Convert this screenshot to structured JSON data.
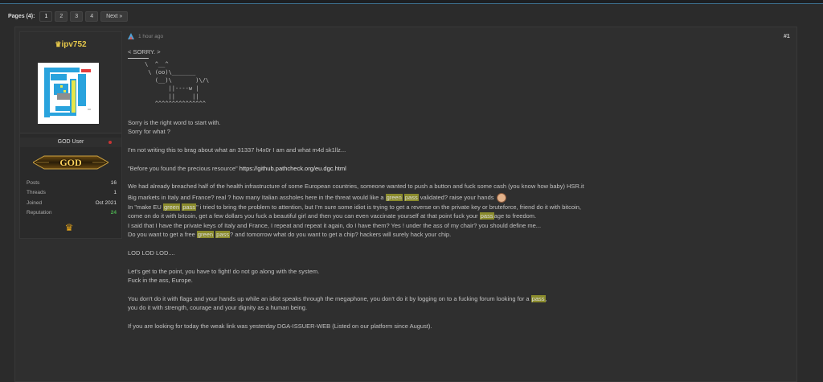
{
  "pagination": {
    "label": "Pages (4):",
    "pages": [
      "1",
      "2",
      "3",
      "4"
    ],
    "next": "Next »"
  },
  "user": {
    "name": "ipv752",
    "title": "GOD User",
    "rank": "GOD",
    "stats": [
      {
        "label": "Posts",
        "value": "16"
      },
      {
        "label": "Threads",
        "value": "1"
      },
      {
        "label": "Joined",
        "value": "Oct 2021"
      },
      {
        "label": "Reputation",
        "value": "24"
      }
    ]
  },
  "post": {
    "time": "1 hour ago",
    "number": "#1",
    "line_sorry": "< SORRY. >",
    "ascii": [
      "     \\  ^__^",
      "      \\ (oo)\\_______",
      "        (__)\\       )\\/\\",
      "            ||----w |",
      "            ||     ||",
      "        ^^^^^^^^^^^^^^^"
    ],
    "p1": "Sorry is the right word to start with.",
    "p2": "Sorry for what ?",
    "p3": "I'm not writing this to brag about what an 31337 h4x0r I am and what m4d sk1llz...",
    "p4_pre": "\"Before you found the precious resource\" ",
    "p4_link": "https://github.pathcheck.org/eu.dgc.html",
    "p5": "We had already breached half of the health infrastructure of some European countries, someone wanted to push a button and fuck some cash (you know how baby) HSR.it",
    "p6_a": "Big markets in Italy and France? real ? how many Italian assholes here in the threat would like a ",
    "hl_green": "green",
    "hl_pass": "pass",
    "p6_b": " validated? raise your hands",
    "p7_a": "In \"make EU ",
    "p7_b": "\" i tried to bring the problem to attention, but I'm sure some idiot is trying to get a reverse on the private key or bruteforce, friend do it with bitcoin,",
    "p8": "come on do it with bitcoin, get a few dollars you fuck a beautiful girl and then you can even vaccinate yourself at that point fuck your ",
    "p8_hl": "pass",
    "p8_b": "age to freedom.",
    "p9": "I said that I have the private keys of Italy and France, I repeat and repeat it again, do I have them? Yes ! under the ass of my chair? you should define me...",
    "p10_a": "Do you want to get a free ",
    "p10_b": "? and tomorrow what do you want to get a chip? hackers will surely hack your chip.",
    "p11": "LOD LOD LOD....",
    "p12": "Let's get to the point, you have to fight! do not go along with the system.",
    "p13": "Fuck in the ass, Europe.",
    "p14_a": "You don't do it with flags and your hands up while an idiot speaks through the megaphone, you don't do it by logging on to a fucking forum looking for a ",
    "p14_b": ",",
    "p15": "you do it with strength, courage and your dignity as a human being.",
    "p16": "If you are looking for today the weak link was yesterday DGA-ISSUER-WEB (Listed on our platform since August)."
  },
  "colors": {
    "background": "#2b2b2b",
    "username": "#e6c84a",
    "highlight": "#8a8b2c",
    "reputation": "#4caf50"
  }
}
